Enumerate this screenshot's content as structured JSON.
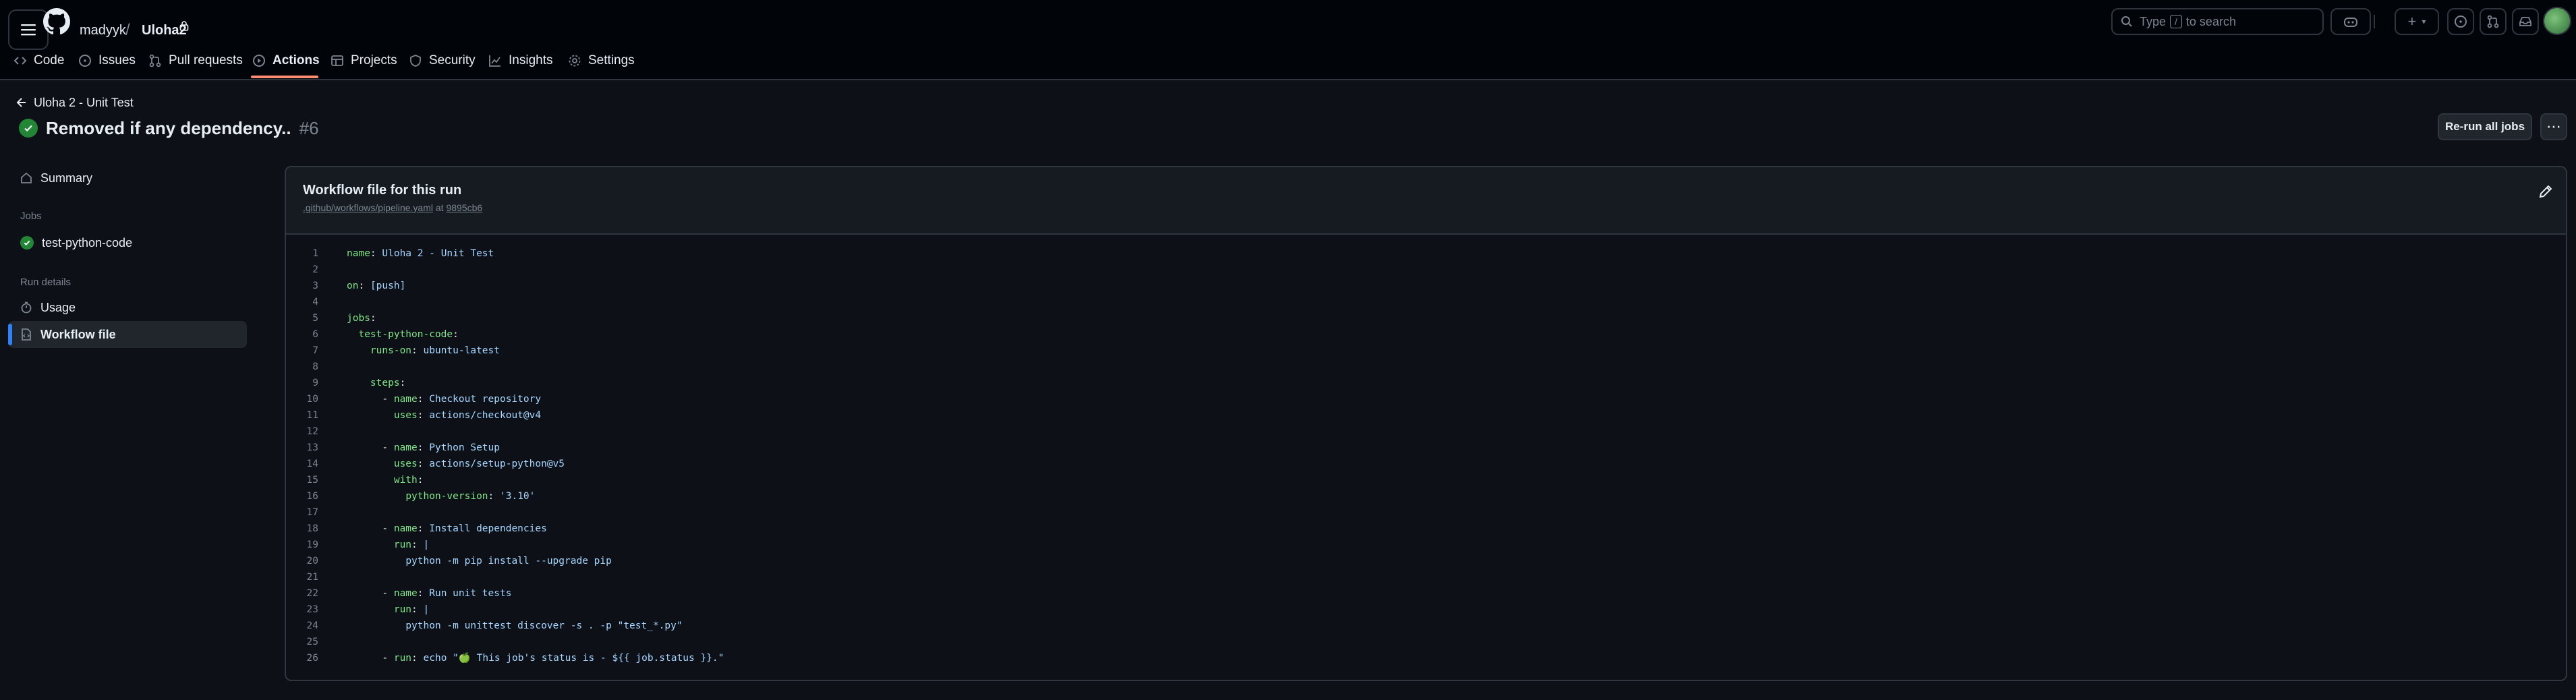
{
  "header": {
    "owner": "madyyk",
    "separator": "/",
    "repo": "Uloha2",
    "search_prefix": "Type",
    "search_key": "/",
    "search_suffix": "to search"
  },
  "tabs": [
    {
      "label": "Code",
      "icon": "code-icon"
    },
    {
      "label": "Issues",
      "icon": "issue-icon"
    },
    {
      "label": "Pull requests",
      "icon": "pull-request-icon"
    },
    {
      "label": "Actions",
      "icon": "play-icon",
      "active": true
    },
    {
      "label": "Projects",
      "icon": "table-icon"
    },
    {
      "label": "Security",
      "icon": "shield-icon"
    },
    {
      "label": "Insights",
      "icon": "graph-icon"
    },
    {
      "label": "Settings",
      "icon": "gear-icon"
    }
  ],
  "run": {
    "back_label": "Uloha 2 - Unit Test",
    "title": "Removed if any dependency..",
    "number": "#6",
    "rerun_label": "Re-run all jobs"
  },
  "sidebar": {
    "summary": "Summary",
    "jobs_heading": "Jobs",
    "job": "test-python-code",
    "details_heading": "Run details",
    "usage": "Usage",
    "workflow_file": "Workflow file"
  },
  "panel": {
    "title": "Workflow file for this run",
    "path": ".github/workflows/pipeline.yaml",
    "at": "at",
    "commit": "9895cb6"
  },
  "code": [
    {
      "n": "1",
      "indent": "",
      "key": "name",
      "sep": ": ",
      "val": "Uloha 2 - Unit Test"
    },
    {
      "n": "2",
      "indent": "",
      "key": "",
      "sep": "",
      "val": ""
    },
    {
      "n": "3",
      "indent": "",
      "key": "on",
      "sep": ": ",
      "val": "[push]"
    },
    {
      "n": "4",
      "indent": "",
      "key": "",
      "sep": "",
      "val": ""
    },
    {
      "n": "5",
      "indent": "",
      "key": "jobs",
      "sep": ":",
      "val": ""
    },
    {
      "n": "6",
      "indent": "  ",
      "key": "test-python-code",
      "sep": ":",
      "val": ""
    },
    {
      "n": "7",
      "indent": "    ",
      "key": "runs-on",
      "sep": ": ",
      "val": "ubuntu-latest"
    },
    {
      "n": "8",
      "indent": "",
      "key": "",
      "sep": "",
      "val": ""
    },
    {
      "n": "9",
      "indent": "    ",
      "key": "steps",
      "sep": ":",
      "val": ""
    },
    {
      "n": "10",
      "indent": "      - ",
      "key": "name",
      "sep": ": ",
      "val": "Checkout repository"
    },
    {
      "n": "11",
      "indent": "        ",
      "key": "uses",
      "sep": ": ",
      "val": "actions/checkout@v4"
    },
    {
      "n": "12",
      "indent": "",
      "key": "",
      "sep": "",
      "val": ""
    },
    {
      "n": "13",
      "indent": "      - ",
      "key": "name",
      "sep": ": ",
      "val": "Python Setup"
    },
    {
      "n": "14",
      "indent": "        ",
      "key": "uses",
      "sep": ": ",
      "val": "actions/setup-python@v5"
    },
    {
      "n": "15",
      "indent": "        ",
      "key": "with",
      "sep": ":",
      "val": ""
    },
    {
      "n": "16",
      "indent": "          ",
      "key": "python-version",
      "sep": ": ",
      "val": "'3.10'"
    },
    {
      "n": "17",
      "indent": "",
      "key": "",
      "sep": "",
      "val": ""
    },
    {
      "n": "18",
      "indent": "      - ",
      "key": "name",
      "sep": ": ",
      "val": "Install dependencies"
    },
    {
      "n": "19",
      "indent": "        ",
      "key": "run",
      "sep": ": ",
      "val": "|"
    },
    {
      "n": "20",
      "indent": "          ",
      "key": "",
      "sep": "",
      "val": "python -m pip install --upgrade pip"
    },
    {
      "n": "21",
      "indent": "",
      "key": "",
      "sep": "",
      "val": ""
    },
    {
      "n": "22",
      "indent": "      - ",
      "key": "name",
      "sep": ": ",
      "val": "Run unit tests"
    },
    {
      "n": "23",
      "indent": "        ",
      "key": "run",
      "sep": ": ",
      "val": "|"
    },
    {
      "n": "24",
      "indent": "          ",
      "key": "",
      "sep": "",
      "val": "python -m unittest discover -s . -p \"test_*.py\""
    },
    {
      "n": "25",
      "indent": "",
      "key": "",
      "sep": "",
      "val": ""
    },
    {
      "n": "26",
      "indent": "      - ",
      "key": "run",
      "sep": ": ",
      "val": "echo \"🍏 This job's status is - ${{ job.status }}.\""
    }
  ],
  "colors": {
    "background": "#0d1117",
    "header_bg": "#010409",
    "accent_underline": "#fd8c73",
    "success": "#238636",
    "active_marker": "#2f81f7",
    "yaml_key": "#7ee787",
    "yaml_value": "#a5d6ff"
  }
}
